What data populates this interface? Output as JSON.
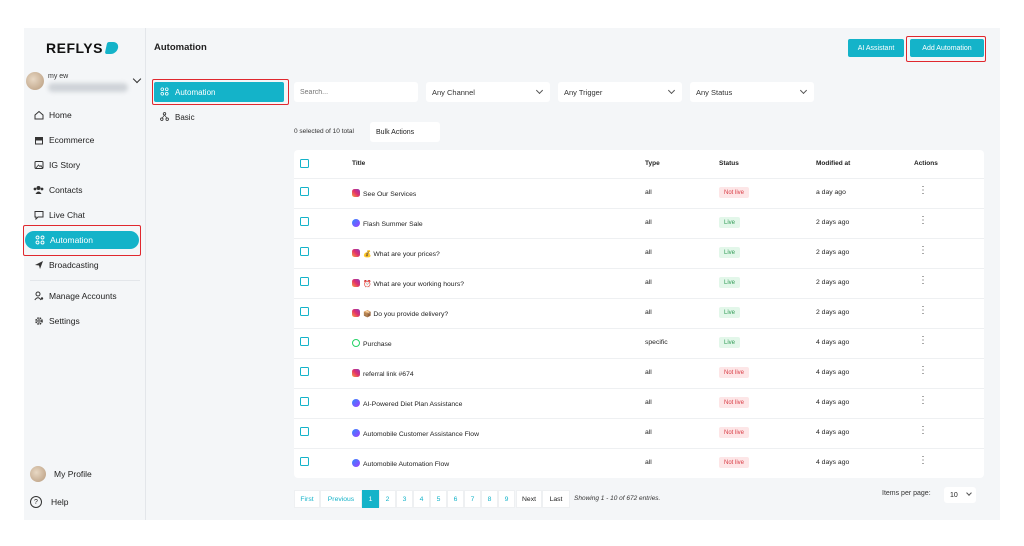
{
  "brand": {
    "name": "REFLYS"
  },
  "profile": {
    "name": "my ew"
  },
  "sidebar": {
    "items": [
      {
        "label": "Home",
        "icon": "home-icon"
      },
      {
        "label": "Ecommerce",
        "icon": "store-icon"
      },
      {
        "label": "IG Story",
        "icon": "image-icon"
      },
      {
        "label": "Contacts",
        "icon": "users-icon"
      },
      {
        "label": "Live Chat",
        "icon": "chat-icon"
      },
      {
        "label": "Automation",
        "icon": "automation-icon",
        "active": true
      },
      {
        "label": "Broadcasting",
        "icon": "send-icon"
      },
      {
        "label": "Manage Accounts",
        "icon": "user-gear-icon"
      },
      {
        "label": "Settings",
        "icon": "gear-icon"
      }
    ],
    "my_profile": "My Profile",
    "help": "Help"
  },
  "page": {
    "title": "Automation"
  },
  "subnav": [
    {
      "label": "Automation",
      "active": true
    },
    {
      "label": "Basic"
    }
  ],
  "toolbar": {
    "ai_assistant": "AI Assistant",
    "add_automation": "Add Automation"
  },
  "filters": {
    "search_placeholder": "Search...",
    "channel": "Any Channel",
    "trigger": "Any Trigger",
    "status": "Any Status"
  },
  "selection": {
    "text": "0 selected of 10 total",
    "bulk_actions": "Bulk Actions"
  },
  "table": {
    "columns": [
      "Title",
      "Type",
      "Status",
      "Modified at",
      "Actions"
    ],
    "rows": [
      {
        "channel": "instagram",
        "title": "See Our Services",
        "type": "all",
        "status": "Not live",
        "modified": "a day ago"
      },
      {
        "channel": "messenger",
        "title": "Flash Summer Sale",
        "type": "all",
        "status": "Live",
        "modified": "2 days ago"
      },
      {
        "channel": "instagram",
        "title": "💰 What are your prices?",
        "type": "all",
        "status": "Live",
        "modified": "2 days ago"
      },
      {
        "channel": "instagram",
        "title": "⏰ What are your working hours?",
        "type": "all",
        "status": "Live",
        "modified": "2 days ago"
      },
      {
        "channel": "instagram",
        "title": "📦 Do you provide delivery?",
        "type": "all",
        "status": "Live",
        "modified": "2 days ago"
      },
      {
        "channel": "whatsapp",
        "title": "Purchase",
        "type": "specific",
        "status": "Live",
        "modified": "4 days ago"
      },
      {
        "channel": "instagram",
        "title": "referral link #674",
        "type": "all",
        "status": "Not live",
        "modified": "4 days ago"
      },
      {
        "channel": "messenger",
        "title": "AI-Powered Diet Plan Assistance",
        "type": "all",
        "status": "Not live",
        "modified": "4 days ago"
      },
      {
        "channel": "messenger",
        "title": "Automobile Customer Assistance Flow",
        "type": "all",
        "status": "Not live",
        "modified": "4 days ago"
      },
      {
        "channel": "messenger",
        "title": "Automobile Automation Flow",
        "type": "all",
        "status": "Not live",
        "modified": "4 days ago"
      }
    ]
  },
  "pagination": {
    "first": "First",
    "previous": "Previous",
    "pages": [
      "1",
      "2",
      "3",
      "4",
      "5",
      "6",
      "7",
      "8",
      "9"
    ],
    "current": "1",
    "next": "Next",
    "last": "Last",
    "showing": "Showing 1 - 10 of 672 entries.",
    "items_per_page_label": "Items per page:",
    "items_per_page": "10"
  },
  "colors": {
    "accent": "#14b3c9",
    "highlight": "#e0282e",
    "not_live": "#d83b44",
    "live": "#2e9a54"
  }
}
